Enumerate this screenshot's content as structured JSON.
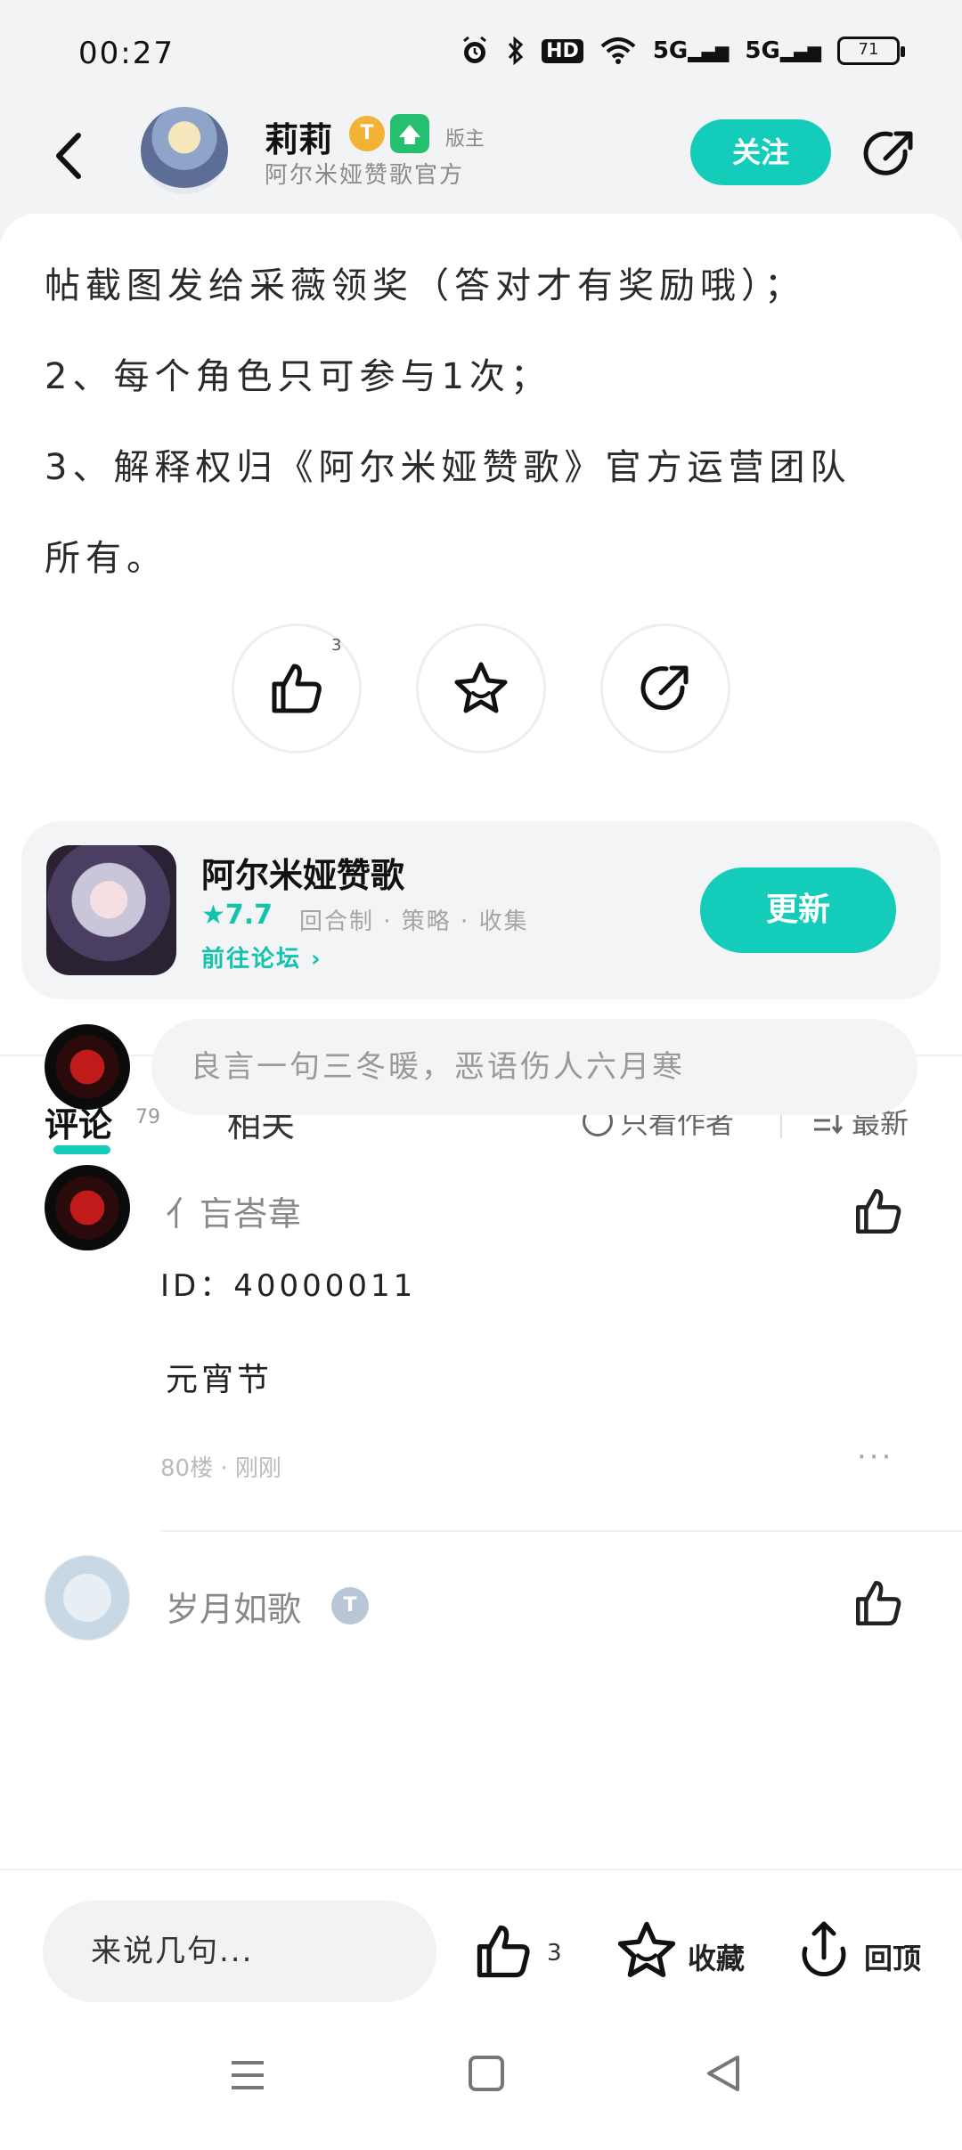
{
  "status_bar": {
    "time": "00:27",
    "icons": [
      "alarm-icon",
      "bluetooth-icon",
      "hd-icon",
      "wifi-icon",
      "signal-5g-icon",
      "signal-5g-icon",
      "battery-icon"
    ],
    "hd_label": "HD",
    "net1": "5G",
    "net2": "5G",
    "battery": "71"
  },
  "header": {
    "author_name": "莉莉",
    "level_badge": "T",
    "role": "版主",
    "author_subtitle": "阿尔米娅赞歌官方",
    "follow_label": "关注"
  },
  "article": {
    "lines": [
      "帖截图发给采薇领奖（答对才有奖励哦）；",
      "2、每个角色只可参与1次；",
      "3、解释权归《阿尔米娅赞歌》官方运营团队",
      "所有。"
    ]
  },
  "post_actions": {
    "like_count": "3"
  },
  "game_card": {
    "title": "阿尔米娅赞歌",
    "rating": "★7.7",
    "tags": "回合制 · 策略 · 收集",
    "forum_link": "前往论坛 ›",
    "update_label": "更新"
  },
  "tabs": {
    "comment_label": "评论",
    "comment_count": "79",
    "related_label": "相关",
    "author_only_label": "只看作者",
    "sort_label": "最新"
  },
  "comment_input": {
    "placeholder": "良言一句三冬暖，恶语伤人六月寒"
  },
  "comments": [
    {
      "name": "亻吂峇韋",
      "line1": "ID：40000011",
      "line2": "元宵节",
      "meta": "80楼 · 刚刚",
      "more": "···"
    },
    {
      "name": "岁月如歌",
      "badge": "T"
    }
  ],
  "bottom_bar": {
    "input_placeholder": "来说几句...",
    "like_count": "3",
    "favorite_label": "收藏",
    "top_label": "回顶"
  },
  "colors": {
    "accent": "#14ccba",
    "background": "#f1f3f5"
  }
}
